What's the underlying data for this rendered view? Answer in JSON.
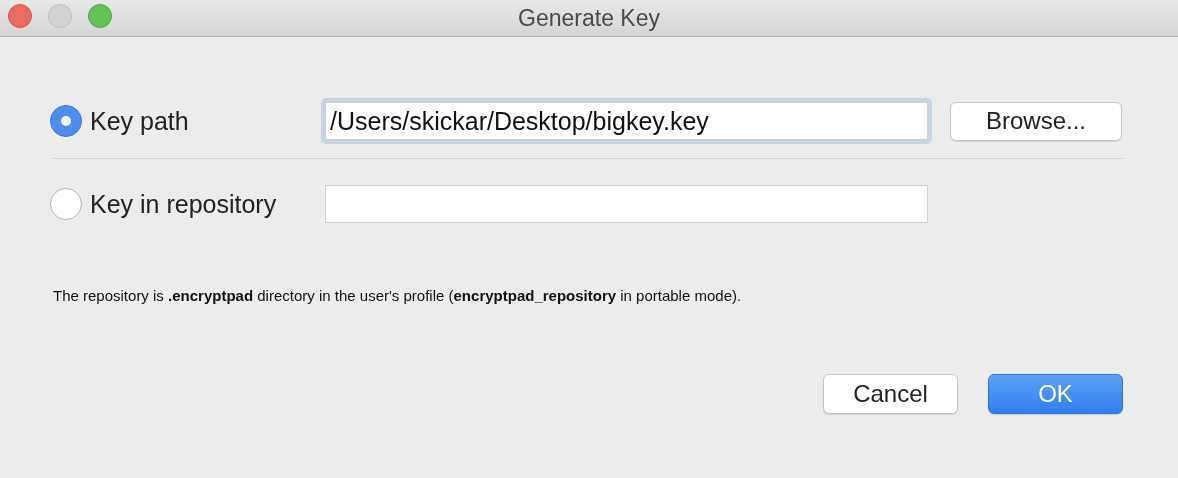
{
  "window": {
    "title": "Generate Key"
  },
  "options": [
    {
      "label": "Key path",
      "selected": true,
      "value": "/Users/skickar/Desktop/bigkey.key",
      "focused": true,
      "button": "Browse..."
    },
    {
      "label": "Key in repository",
      "selected": false,
      "focused": false
    }
  ],
  "note": "The repository is **.encryptpad** directory in the user's profile (**encryptpad_repository** in portable mode).",
  "buttons": [
    {
      "label": "Cancel",
      "default": false
    },
    {
      "label": "OK",
      "default": true
    }
  ]
}
